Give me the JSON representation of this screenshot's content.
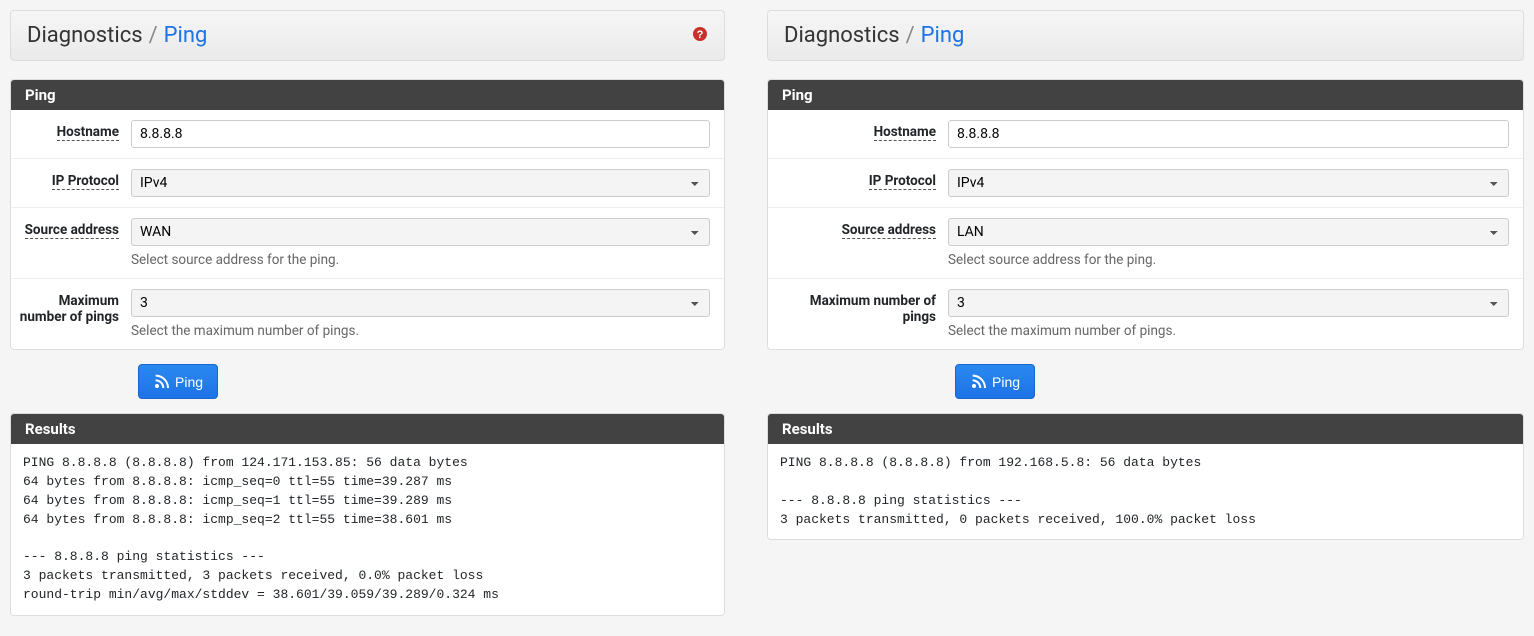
{
  "left": {
    "breadcrumb": {
      "parent": "Diagnostics",
      "sep": "/",
      "current": "Ping"
    },
    "helpIcon": "?",
    "panels": {
      "ping": {
        "title": "Ping",
        "hostname": {
          "label": "Hostname",
          "value": "8.8.8.8"
        },
        "ipproto": {
          "label": "IP Protocol",
          "value": "IPv4"
        },
        "source": {
          "label": "Source address",
          "value": "WAN",
          "help": "Select source address for the ping."
        },
        "maxpings": {
          "label": "Maximum number of pings",
          "value": "3",
          "help": "Select the maximum number of pings."
        }
      },
      "pingButton": "Ping",
      "results": {
        "title": "Results",
        "text": "PING 8.8.8.8 (8.8.8.8) from 124.171.153.85: 56 data bytes\n64 bytes from 8.8.8.8: icmp_seq=0 ttl=55 time=39.287 ms\n64 bytes from 8.8.8.8: icmp_seq=1 ttl=55 time=39.289 ms\n64 bytes from 8.8.8.8: icmp_seq=2 ttl=55 time=38.601 ms\n\n--- 8.8.8.8 ping statistics ---\n3 packets transmitted, 3 packets received, 0.0% packet loss\nround-trip min/avg/max/stddev = 38.601/39.059/39.289/0.324 ms"
      }
    }
  },
  "right": {
    "breadcrumb": {
      "parent": "Diagnostics",
      "sep": "/",
      "current": "Ping"
    },
    "panels": {
      "ping": {
        "title": "Ping",
        "hostname": {
          "label": "Hostname",
          "value": "8.8.8.8"
        },
        "ipproto": {
          "label": "IP Protocol",
          "value": "IPv4"
        },
        "source": {
          "label": "Source address",
          "value": "LAN",
          "help": "Select source address for the ping."
        },
        "maxpings": {
          "label": "Maximum number of pings",
          "value": "3",
          "help": "Select the maximum number of pings."
        }
      },
      "pingButton": "Ping",
      "results": {
        "title": "Results",
        "text": "PING 8.8.8.8 (8.8.8.8) from 192.168.5.8: 56 data bytes\n\n--- 8.8.8.8 ping statistics ---\n3 packets transmitted, 0 packets received, 100.0% packet loss"
      }
    }
  }
}
